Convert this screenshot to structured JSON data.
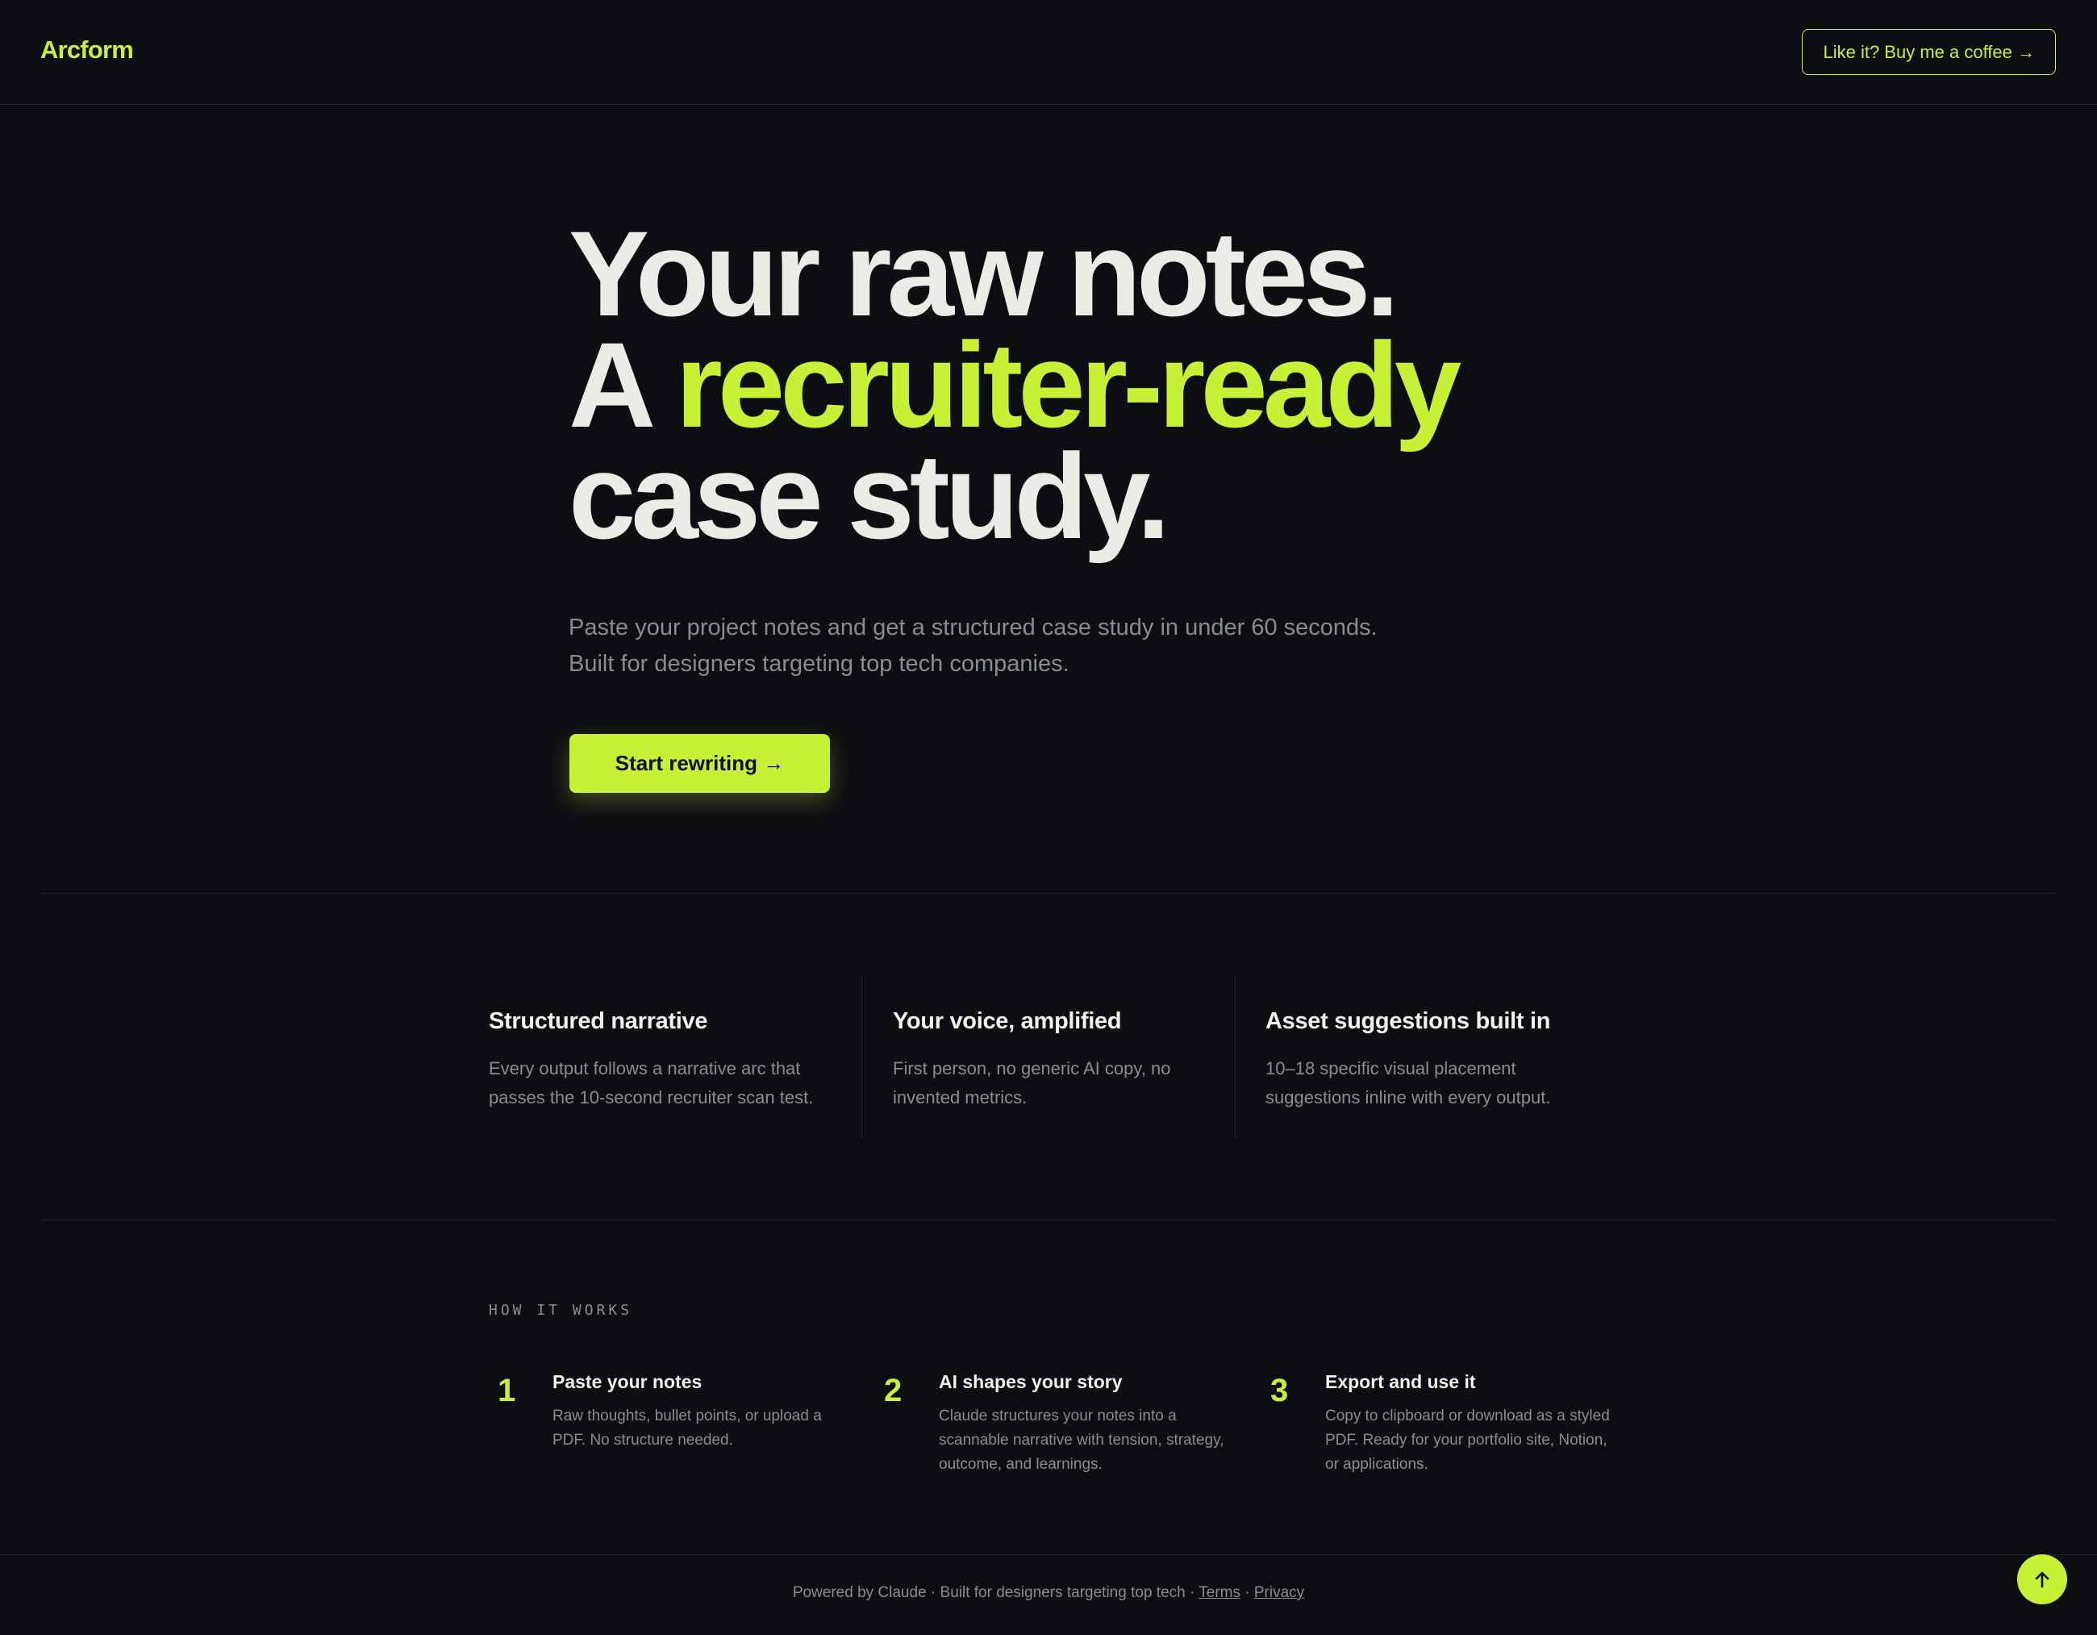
{
  "header": {
    "logo": "Arcform",
    "coffee_button": "Like it? Buy me a coffee →"
  },
  "hero": {
    "line1": "Your raw notes.",
    "line2_prefix": "A ",
    "line2_accent": "recruiter-ready",
    "line3": "case study.",
    "subtitle": "Paste your project notes and get a structured case study in under 60 seconds. Built for designers targeting top tech companies.",
    "cta": "Start rewriting →"
  },
  "features": [
    {
      "title": "Structured narrative",
      "desc": "Every output follows a narrative arc that passes the 10-second recruiter scan test."
    },
    {
      "title": "Your voice, amplified",
      "desc": "First person, no generic AI copy, no invented metrics."
    },
    {
      "title": "Asset suggestions built in",
      "desc": "10–18 specific visual placement suggestions inline with every output."
    }
  ],
  "how_it_works": {
    "label": "HOW IT WORKS",
    "steps": [
      {
        "num": "1",
        "title": "Paste your notes",
        "desc": "Raw thoughts, bullet points, or upload a PDF. No structure needed."
      },
      {
        "num": "2",
        "title": "AI shapes your story",
        "desc": "Claude structures your notes into a scannable narrative with tension, strategy, outcome, and learnings."
      },
      {
        "num": "3",
        "title": "Export and use it",
        "desc": "Copy to clipboard or download as a styled PDF. Ready for your portfolio site, Notion, or applications."
      }
    ]
  },
  "footer": {
    "text": "Powered by Claude · Built for designers targeting top tech · ",
    "terms": "Terms",
    "separator": " · ",
    "privacy": "Privacy"
  },
  "icons": {
    "scroll_top": "arrow-up-icon"
  },
  "colors": {
    "accent": "#c8f135",
    "background": "#0d0e12",
    "text": "#ecece6",
    "muted": "#8a8c94",
    "border": "#22242a"
  }
}
